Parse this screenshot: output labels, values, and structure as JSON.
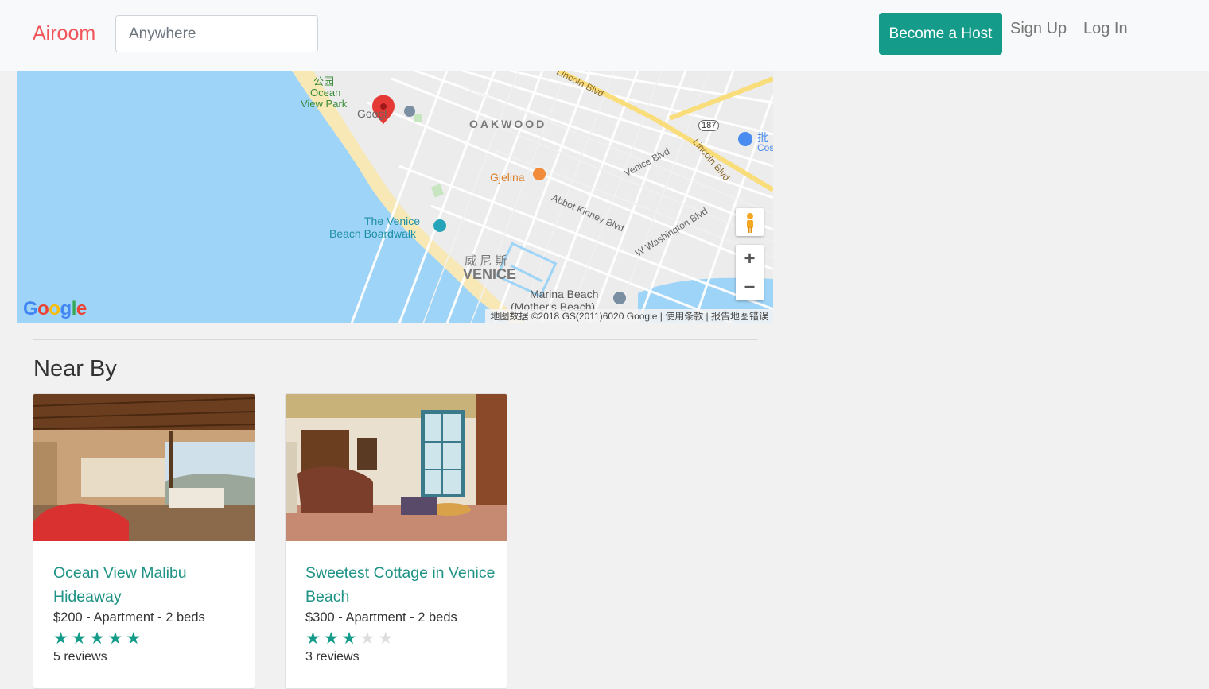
{
  "navbar": {
    "brand": "Airoom",
    "search_placeholder": "Anywhere",
    "become_host": "Become a Host",
    "sign_up": "Sign Up",
    "log_in": "Log In"
  },
  "map": {
    "labels": {
      "ocean_view_park_cn": "公园",
      "ocean_view_park": "Ocean",
      "ocean_view_park2": "View Park",
      "google_poi": "Googl",
      "oakwood": "OAKWOOD",
      "gjelina": "Gjelina",
      "venice_boardwalk1": "The Venice",
      "venice_boardwalk2": "Beach Boardwalk",
      "venice_cn": "威 尼 斯",
      "venice": "VENICE",
      "marina_beach1": "Marina Beach",
      "marina_beach2": "(Mother's Beach)",
      "lincoln_blvd": "Lincoln Blvd",
      "lincoln_blvd2": "Lincoln Blvd",
      "venice_blvd": "Venice Blvd",
      "abbot_kinney": "Abbot Kinney Blvd",
      "w_washington": "W Washington Blvd",
      "route_187": "187",
      "poi_cn": "批",
      "poi_cn2": "Cos"
    },
    "logo": "Google",
    "copyright": "地图数据 ©2018 GS(2011)6020 Google | 使用条款 | 报告地图错误",
    "zoom_in": "+",
    "zoom_out": "−",
    "colors": {
      "water": "#9ed4f7",
      "sand": "#f7e8b5",
      "roads": "#ffffff",
      "land": "#ececec",
      "highway": "#f9dd7a",
      "marker": "#e53935"
    }
  },
  "nearby": {
    "title": "Near By",
    "listings": [
      {
        "title": "Ocean View Malibu Hideaway",
        "meta": "$200 - Apartment - 2 beds",
        "rating": 5,
        "reviews": "5 reviews"
      },
      {
        "title": "Sweetest Cottage in Venice Beach",
        "meta": "$300 - Apartment - 2 beds",
        "rating": 3,
        "reviews": "3 reviews"
      }
    ],
    "star_color_on": "#149b8a",
    "star_color_off": "#dddddd"
  }
}
